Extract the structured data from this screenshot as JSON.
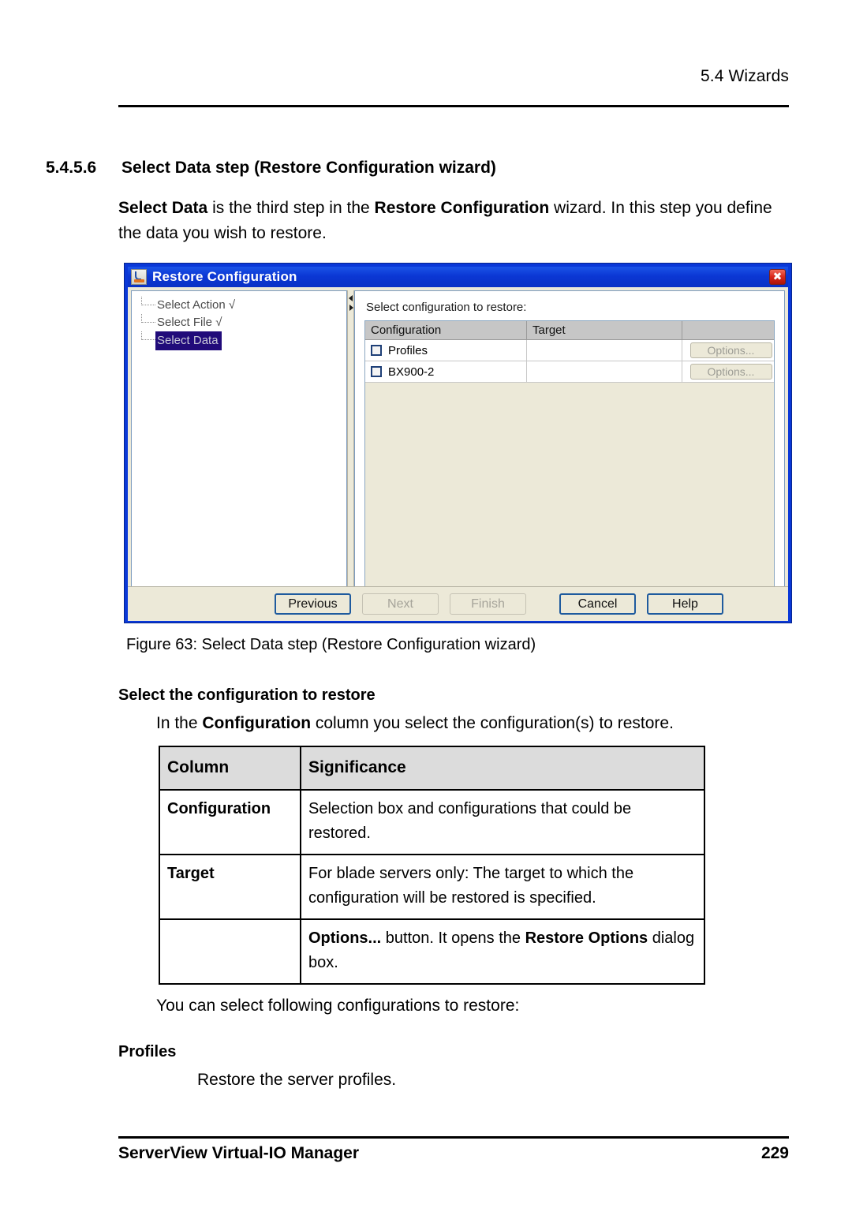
{
  "page": {
    "running_head": "5.4 Wizards",
    "footer_left": "ServerView Virtual-IO Manager",
    "footer_page": "229"
  },
  "section": {
    "number": "5.4.5.6",
    "title": "Select Data step (Restore Configuration wizard)",
    "intro_before": "Select Data",
    "intro_mid": " is the third step in the ",
    "intro_bold2": "Restore Configuration",
    "intro_after": " wizard. In this step you define the data you wish to restore."
  },
  "dialog": {
    "title": "Restore Configuration",
    "icon": "java-coffee-cup-icon",
    "close_label": "✖",
    "tree": {
      "items": [
        {
          "label": "Select Action √",
          "selected": false
        },
        {
          "label": "Select File √",
          "selected": false
        },
        {
          "label": "Select Data",
          "selected": true
        }
      ]
    },
    "pane_label": "Select configuration to restore:",
    "table": {
      "headers": [
        "Configuration",
        "Target",
        ""
      ],
      "rows": [
        {
          "config": "Profiles",
          "checked": false,
          "target": "",
          "button": "Options..."
        },
        {
          "config": "BX900-2",
          "checked": false,
          "target": "",
          "button": "Options..."
        }
      ]
    },
    "buttons": [
      {
        "label": "Previous",
        "state": "enabled-default"
      },
      {
        "label": "Next",
        "state": "disabled"
      },
      {
        "label": "Finish",
        "state": "disabled"
      },
      {
        "label": "Cancel",
        "state": "enabled-default"
      },
      {
        "label": "Help",
        "state": "enabled-default"
      }
    ]
  },
  "figure": {
    "caption": "Figure 63: Select Data step (Restore Configuration wizard)"
  },
  "content": {
    "subhead_select": "Select the configuration to restore",
    "cfg_para_pre": "In the ",
    "cfg_para_bold": "Configuration",
    "cfg_para_post": " column you select the configuration(s) to restore.",
    "sig_table": {
      "headers": [
        "Column",
        "Significance"
      ],
      "rows": [
        {
          "column": "Configuration",
          "significance": "Selection box and configurations that could be restored."
        },
        {
          "column": "Target",
          "significance": "For blade servers only: The target to which the configuration will be restored is specified."
        },
        {
          "column": "",
          "sig_bold1": "Options...",
          "sig_mid": " button. It opens the ",
          "sig_bold2": "Restore Options",
          "sig_end": " dialog box."
        }
      ]
    },
    "you_can_para": "You can select following configurations to restore:",
    "subhead_profiles": "Profiles",
    "profiles_desc": "Restore the server profiles."
  },
  "colors": {
    "title_bar": "#0a38d8",
    "tree_selection": "#210b7a",
    "dialog_face": "#ece9d8",
    "table_header": "#c6c6c6",
    "close_button": "#d8281a"
  }
}
